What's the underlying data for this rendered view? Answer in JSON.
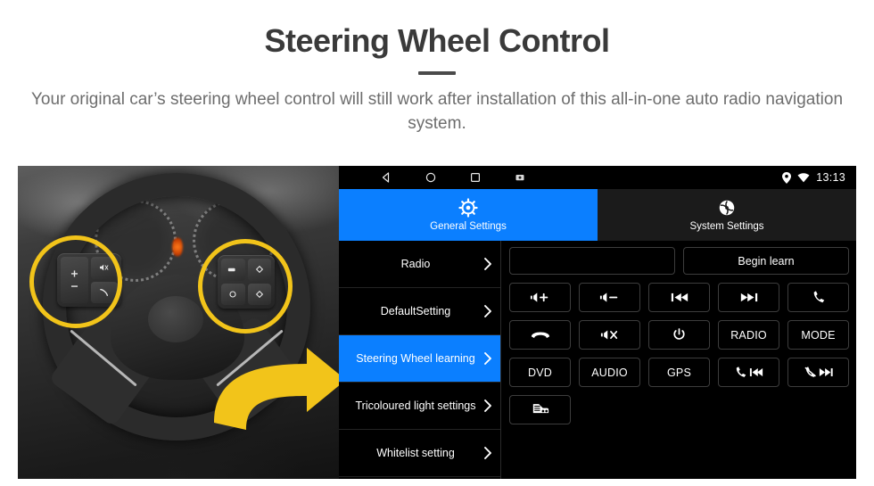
{
  "header": {
    "title": "Steering Wheel Control",
    "subtitle": "Your original car’s steering wheel control will still work after installation of this all-in-one auto radio navigation system."
  },
  "photo": {
    "alt_name": "steering-wheel-photo",
    "highlight_color": "#f2c41a",
    "left_pad_keys": [
      "+",
      "−",
      "mute-icon",
      "phone-icon"
    ],
    "right_pad_keys": [
      "media-icon",
      "diamond-up-icon",
      "circle-icon",
      "diamond-down-icon"
    ]
  },
  "unit": {
    "statusbar": {
      "nav": [
        {
          "name": "back-icon"
        },
        {
          "name": "home-icon"
        },
        {
          "name": "recents-icon"
        },
        {
          "name": "screenshot-icon"
        }
      ],
      "location_icon": "location-pin-icon",
      "wifi_icon": "wifi-icon",
      "time": "13:13"
    },
    "tabs": [
      {
        "label": "General Settings",
        "icon": "brightness-gear-icon",
        "active": true,
        "color": "#0B7FFF"
      },
      {
        "label": "System Settings",
        "icon": "system-wrench-icon",
        "active": false,
        "color": "#1b1b1b"
      }
    ],
    "sidebar": {
      "items": [
        {
          "label": "Radio",
          "active": false
        },
        {
          "label": "DefaultSetting",
          "active": false
        },
        {
          "label": "Steering Wheel learning",
          "active": true
        },
        {
          "label": "Tricoloured light settings",
          "active": false
        },
        {
          "label": "Whitelist setting",
          "active": false
        }
      ]
    },
    "pane": {
      "input_value": "",
      "begin_learn_label": "Begin learn",
      "buttons": [
        {
          "name": "volume-up-button",
          "icon": "speaker-icon",
          "label": "+"
        },
        {
          "name": "volume-down-button",
          "icon": "speaker-icon",
          "label": "−"
        },
        {
          "name": "previous-track-button",
          "icon": "previous-icon",
          "label": ""
        },
        {
          "name": "next-track-button",
          "icon": "next-icon",
          "label": ""
        },
        {
          "name": "answer-call-button",
          "icon": "phone-icon",
          "label": ""
        },
        {
          "name": "hang-up-button",
          "icon": "phone-hangup-icon",
          "label": ""
        },
        {
          "name": "mute-button",
          "icon": "speaker-icon",
          "label": "x"
        },
        {
          "name": "power-button",
          "icon": "power-icon",
          "label": ""
        },
        {
          "name": "radio-button",
          "icon": "",
          "label": "RADIO"
        },
        {
          "name": "mode-button",
          "icon": "",
          "label": "MODE"
        },
        {
          "name": "dvd-button",
          "icon": "",
          "label": "DVD"
        },
        {
          "name": "audio-button",
          "icon": "",
          "label": "AUDIO"
        },
        {
          "name": "gps-button",
          "icon": "",
          "label": "GPS"
        },
        {
          "name": "call-previous-button",
          "icon": "phone-previous-icon",
          "label": ""
        },
        {
          "name": "hangup-next-button",
          "icon": "hangup-next-icon",
          "label": ""
        },
        {
          "name": "car-navigation-button",
          "icon": "car-front-icon",
          "label": ""
        }
      ]
    }
  }
}
